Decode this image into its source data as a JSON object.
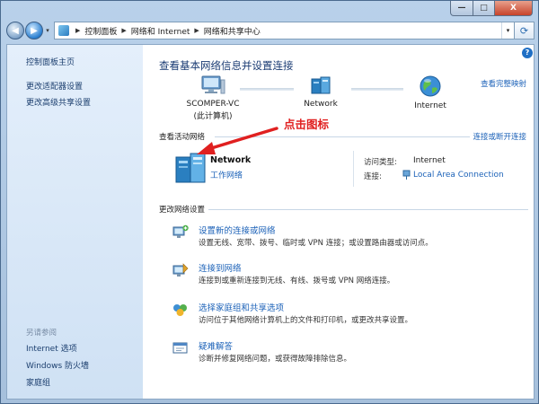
{
  "window": {
    "buttons": {
      "minimize": "—",
      "maximize": "□",
      "close": "X"
    }
  },
  "addressbar": {
    "crumbs": [
      "控制面板",
      "网络和 Internet",
      "网络和共享中心"
    ],
    "search_placeholder": ""
  },
  "sidebar": {
    "items": [
      "控制面板主页",
      "更改适配器设置",
      "更改高级共享设置"
    ],
    "see_also_label": "另请参阅",
    "see_also": [
      "Internet 选项",
      "Windows 防火墙",
      "家庭组"
    ]
  },
  "main": {
    "title": "查看基本网络信息并设置连接",
    "view_full_map": "查看完整映射",
    "map": {
      "computer_name": "SCOMPER-VC",
      "computer_sub": "(此计算机)",
      "network_name": "Network",
      "internet_name": "Internet"
    },
    "active_networks": {
      "heading": "查看活动网络",
      "connect_link": "连接或断开连接",
      "network_name": "Network",
      "network_type": "工作网络",
      "access_type_label": "访问类型:",
      "access_type_value": "Internet",
      "connection_label": "连接:",
      "connection_value": "Local Area Connection"
    },
    "change_settings": {
      "heading": "更改网络设置",
      "tasks": [
        {
          "title": "设置新的连接或网络",
          "desc": "设置无线、宽带、拨号、临时或 VPN 连接；或设置路由器或访问点。",
          "icon": "new-connection-icon"
        },
        {
          "title": "连接到网络",
          "desc": "连接到或重新连接到无线、有线、拨号或 VPN 网络连接。",
          "icon": "connect-network-icon"
        },
        {
          "title": "选择家庭组和共享选项",
          "desc": "访问位于其他网络计算机上的文件和打印机，或更改共享设置。",
          "icon": "homegroup-icon"
        },
        {
          "title": "疑难解答",
          "desc": "诊断并修复网络问题，或获得故障排除信息。",
          "icon": "troubleshoot-icon"
        }
      ]
    },
    "annotation": "点击图标"
  },
  "colors": {
    "link": "#1c62b8",
    "title": "#1a3b73",
    "annotation": "#e02020"
  }
}
